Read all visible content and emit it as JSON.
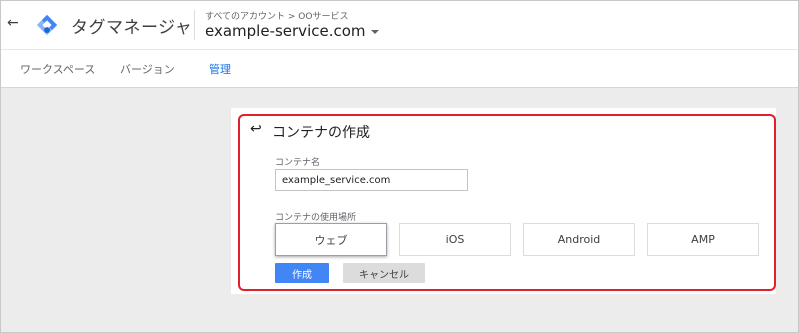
{
  "header": {
    "back_icon": "back-arrow-icon",
    "logo_icon": "gtm-diamond-icon",
    "app_title": "タグマネージャ",
    "breadcrumb": "すべてのアカウント > OOサービス",
    "service_name": "example-service.com",
    "caret_icon": "caret-down-icon"
  },
  "nav": {
    "tabs": [
      {
        "label": "ワークスペース",
        "active": false
      },
      {
        "label": "バージョン",
        "active": false
      },
      {
        "label": "管理",
        "active": true
      }
    ]
  },
  "dialog": {
    "back_icon": "return-arrow-icon",
    "title": "コンテナの作成",
    "name_label": "コンテナ名",
    "name_value": "example_service.com",
    "platform_label": "コンテナの使用場所",
    "platforms": [
      {
        "label": "ウェブ",
        "selected": true
      },
      {
        "label": "iOS",
        "selected": false
      },
      {
        "label": "Android",
        "selected": false
      },
      {
        "label": "AMP",
        "selected": false
      }
    ],
    "create_label": "作成",
    "cancel_label": "キャンセル"
  },
  "colors": {
    "accent": "#1a73e8",
    "primary_button": "#4285f4",
    "highlight_border": "#e0202c",
    "background": "#ececec"
  }
}
